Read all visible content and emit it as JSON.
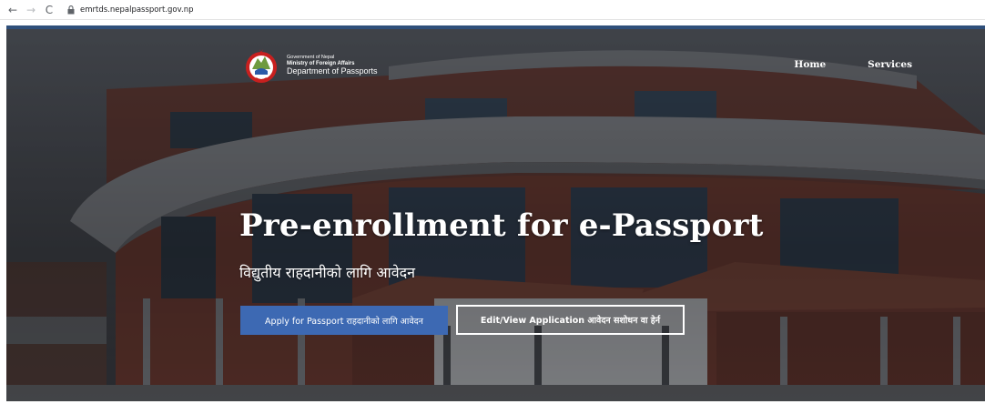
{
  "browser": {
    "url": "emrtds.nepalpassport.gov.np",
    "back_icon": "←",
    "forward_icon": "→",
    "reload_icon": "C"
  },
  "header": {
    "org_line1": "Government of Nepal",
    "org_line2": "Ministry of Foreign Affairs",
    "org_line3": "Department of Passports",
    "nav": [
      {
        "label": "Home"
      },
      {
        "label": "Services"
      }
    ]
  },
  "hero": {
    "title": "Pre-enrollment for e-Passport",
    "subtitle": "विद्युतीय राहदानीको लागि आवेदन",
    "apply_button": "Apply for Passport राहदानीको लागि आवेदन",
    "edit_button": "Edit/View Application आवेदन सशोधन वा हेर्न"
  },
  "colors": {
    "primary_button": "#3d69b3",
    "overlay": "#2f3236"
  }
}
